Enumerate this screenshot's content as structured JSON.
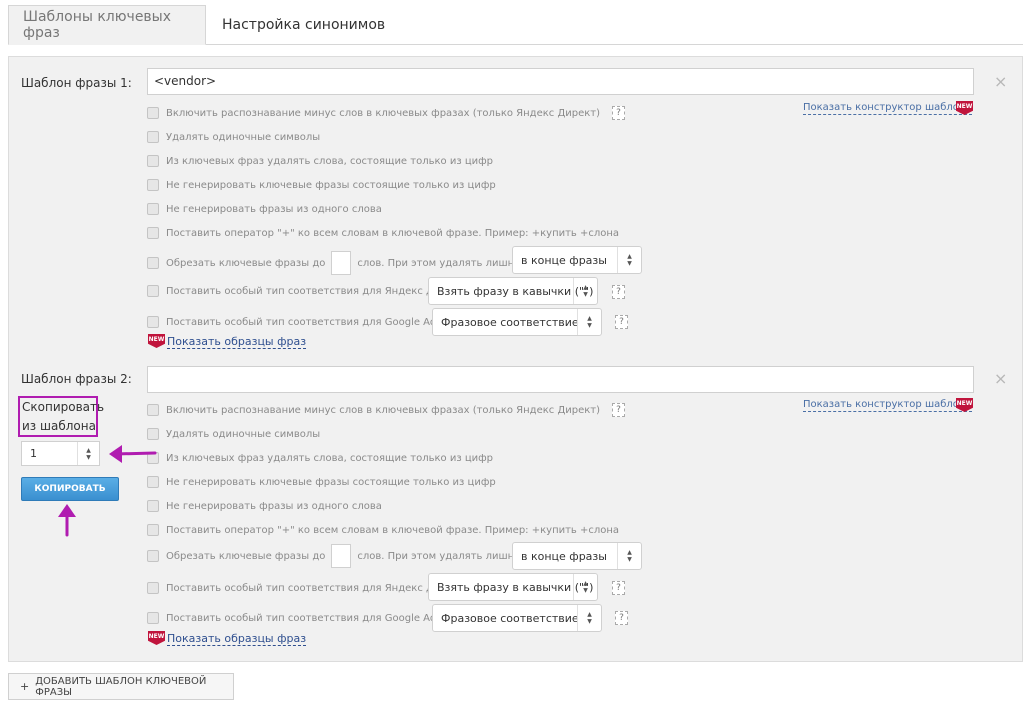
{
  "tabs": [
    {
      "label": "Шаблоны ключевых фраз"
    },
    {
      "label": "Настройка синонимов"
    }
  ],
  "templates": [
    {
      "label": "Шаблон фразы 1:",
      "value": "<vendor>",
      "constructor_link": "Показать конструктор шаблона",
      "options": {
        "minus_words": "Включить распознавание минус слов в ключевых фразах (только Яндекс Директ)",
        "remove_single": "Удалять одиночные символы",
        "remove_digits": "Из ключевых фраз удалять слова, состоящие только из цифр",
        "no_digit_phrases": "Не генерировать ключевые фразы состоящие только из цифр",
        "no_single_word": "Не генерировать фразы из одного слова",
        "plus_operator": "Поставить оператор \"+\" ко всем словам в ключевой фразе. Пример: +купить +слона",
        "trim_before": "Обрезать ключевые фразы до",
        "trim_after": "слов. При этом удалять лишние слова",
        "yandex_match": "Поставить особый тип соответствия для Яндекс Директ",
        "adwords_match": "Поставить особый тип соответствия для Google AdWords"
      },
      "trim_select": "в конце фразы",
      "yandex_select": "Взять фразу в кавычки (\"\")",
      "adwords_select": "Фразовое соответствие",
      "samples_link": "Показать образцы фраз"
    },
    {
      "label": "Шаблон фразы 2:",
      "value": "",
      "constructor_link": "Показать конструктор шаблона",
      "options": {
        "minus_words": "Включить распознавание минус слов в ключевых фразах (только Яндекс Директ)",
        "remove_single": "Удалять одиночные символы",
        "remove_digits": "Из ключевых фраз удалять слова, состоящие только из цифр",
        "no_digit_phrases": "Не генерировать ключевые фразы состоящие только из цифр",
        "no_single_word": "Не генерировать фразы из одного слова",
        "plus_operator": "Поставить оператор \"+\" ко всем словам в ключевой фразе. Пример: +купить +слона",
        "trim_before": "Обрезать ключевые фразы до",
        "trim_after": "слов. При этом удалять лишние слова",
        "yandex_match": "Поставить особый тип соответствия для Яндекс Директ",
        "adwords_match": "Поставить особый тип соответствия для Google AdWords"
      },
      "trim_select": "в конце фразы",
      "yandex_select": "Взять фразу в кавычки (\"\")",
      "adwords_select": "Фразовое соответствие",
      "samples_link": "Показать образцы фраз"
    }
  ],
  "copy": {
    "label": "Скопировать из шаблона",
    "value": "1",
    "button": "КОПИРОВАТЬ"
  },
  "icons": {
    "close": "×",
    "help": "?",
    "new_badge": "NEW",
    "select_up": "▲",
    "select_down": "▼",
    "plus": "+"
  },
  "add_button": "ДОБАВИТЬ ШАБЛОН КЛЮЧЕВОЙ ФРАЗЫ",
  "colors": {
    "accent_link": "#4a6fa5",
    "button_blue": "#3a8fd0",
    "annotation": "#b01cb0",
    "new_badge": "#c0143c"
  }
}
